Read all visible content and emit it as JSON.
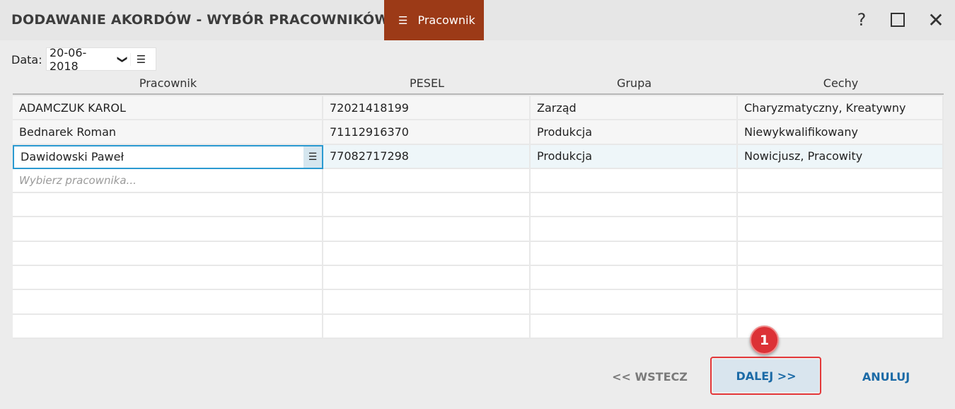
{
  "window": {
    "title": "DODAWANIE AKORDÓW - WYBÓR PRACOWNIKÓW",
    "tab_label": "Pracownik",
    "help_label": "?",
    "close_label": "✕"
  },
  "filter": {
    "date_label": "Data:",
    "date_value": "20-06-2018"
  },
  "grid": {
    "columns": [
      "Pracownik",
      "PESEL",
      "Grupa",
      "Cechy"
    ],
    "rows": [
      {
        "name": "ADAMCZUK KAROL",
        "pesel": "72021418199",
        "group": "Zarząd",
        "traits": "Charyzmatyczny, Kreatywny"
      },
      {
        "name": "Bednarek Roman",
        "pesel": "71112916370",
        "group": "Produkcja",
        "traits": "Niewykwalifikowany"
      },
      {
        "name": "Dawidowski Paweł",
        "pesel": "77082717298",
        "group": "Produkcja",
        "traits": "Nowicjusz, Pracowity"
      }
    ],
    "new_row_placeholder": "Wybierz pracownika...",
    "selected_row": 2
  },
  "footer": {
    "back_label": "<< WSTECZ",
    "next_label": "DALEJ >>",
    "cancel_label": "ANULUJ",
    "callout_number": "1"
  },
  "colors": {
    "accent_tab": "#9c3a17",
    "link_blue": "#1b6aa6",
    "highlight_red": "#e3383a",
    "selection_border": "#2b9ad1"
  }
}
